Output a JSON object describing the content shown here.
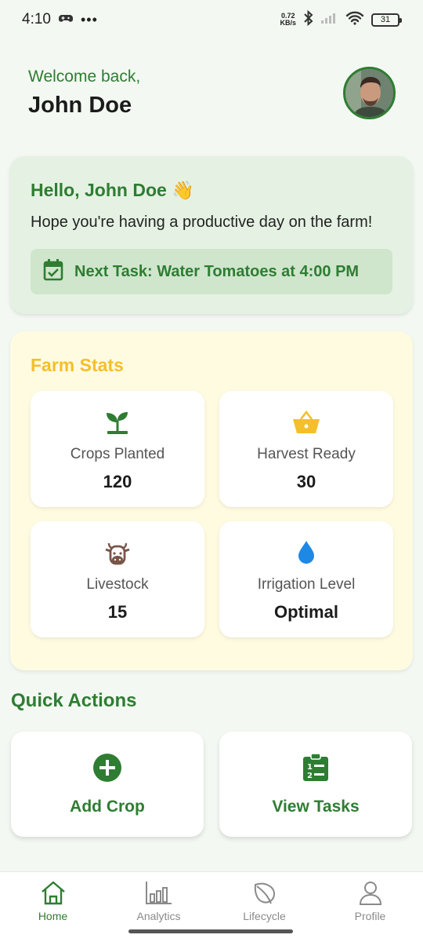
{
  "status_bar": {
    "time": "4:10",
    "speed_value": "0.72",
    "speed_unit": "KB/s",
    "battery": "31"
  },
  "header": {
    "welcome": "Welcome back,",
    "name": "John Doe"
  },
  "greeting": {
    "title": "Hello, John Doe 👋",
    "subtitle": "Hope you're having a productive day on the farm!",
    "next_task": "Next Task: Water Tomatoes at 4:00 PM"
  },
  "farm_stats": {
    "title": "Farm Stats",
    "items": [
      {
        "label": "Crops Planted",
        "value": "120",
        "icon": "sprout-icon"
      },
      {
        "label": "Harvest Ready",
        "value": "30",
        "icon": "basket-icon"
      },
      {
        "label": "Livestock",
        "value": "15",
        "icon": "cow-icon"
      },
      {
        "label": "Irrigation Level",
        "value": "Optimal",
        "icon": "water-drop-icon"
      }
    ]
  },
  "quick_actions": {
    "title": "Quick Actions",
    "items": [
      {
        "label": "Add Crop",
        "icon": "add-circle-icon"
      },
      {
        "label": "View Tasks",
        "icon": "clipboard-list-icon"
      }
    ]
  },
  "bottom_nav": {
    "items": [
      {
        "label": "Home",
        "icon": "home-icon",
        "active": true
      },
      {
        "label": "Analytics",
        "icon": "bar-chart-icon",
        "active": false
      },
      {
        "label": "Lifecycle",
        "icon": "leaf-icon",
        "active": false
      },
      {
        "label": "Profile",
        "icon": "person-icon",
        "active": false
      }
    ]
  },
  "colors": {
    "primary_green": "#2e7d32",
    "stats_yellow": "#f4bf2a",
    "greeting_bg": "#e5f2e3",
    "stats_bg": "#fffbe1"
  }
}
